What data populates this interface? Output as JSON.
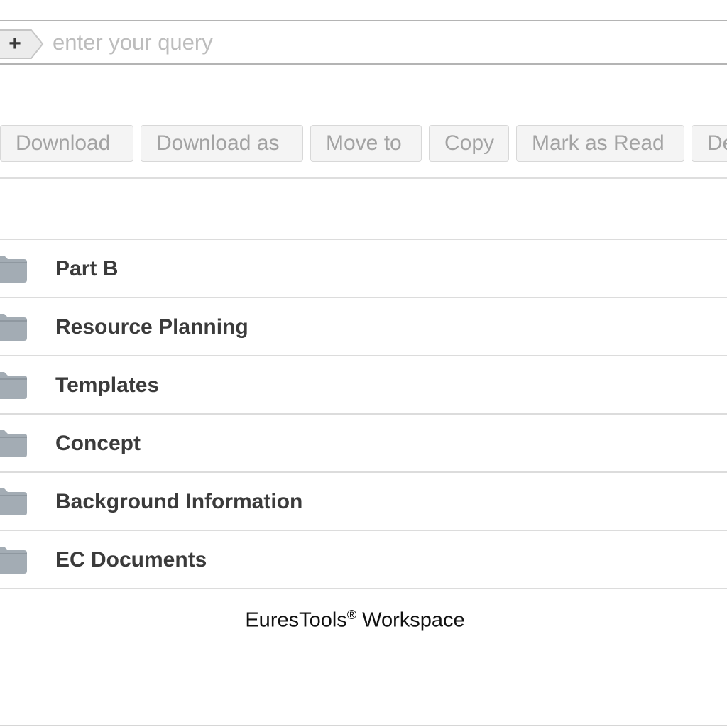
{
  "search": {
    "add_label": "+",
    "placeholder": "enter your query"
  },
  "toolbar": {
    "buttons": [
      {
        "label": "Download"
      },
      {
        "label": "Download as"
      },
      {
        "label": "Move to"
      },
      {
        "label": "Copy"
      },
      {
        "label": "Mark as Read"
      },
      {
        "label": "De"
      }
    ]
  },
  "folders": [
    {
      "name": "Part B",
      "icon": "folder-icon"
    },
    {
      "name": "Resource Planning",
      "icon": "folder-icon"
    },
    {
      "name": "Templates",
      "icon": "folder-icon"
    },
    {
      "name": "Concept",
      "icon": "folder-icon"
    },
    {
      "name": "Background Information",
      "icon": "folder-icon"
    },
    {
      "name": "EC Documents",
      "icon": "folder-icon"
    }
  ],
  "caption": {
    "brand": "EuresTools",
    "mark": "®",
    "suffix": " Workspace"
  },
  "colors": {
    "folder_icon": "#a3acb4",
    "button_text": "#a3a3a3",
    "folder_text": "#3b3b3b"
  }
}
